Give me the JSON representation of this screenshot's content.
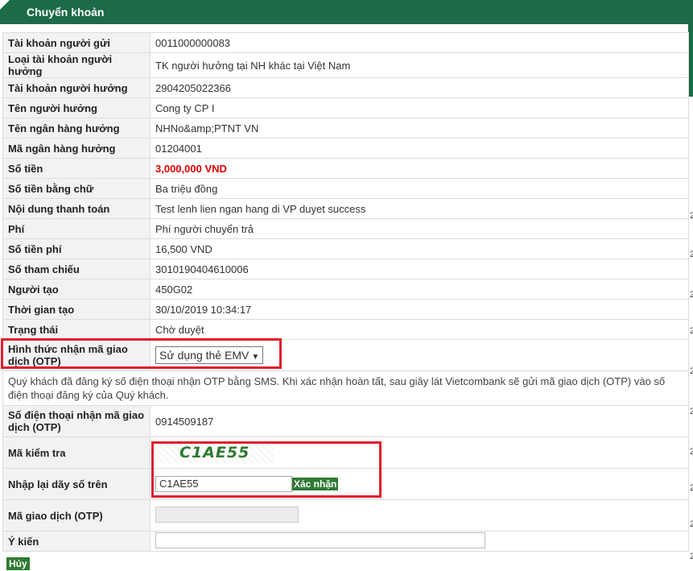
{
  "header": {
    "title": "Chuyển khoản"
  },
  "rows": {
    "sender_account": {
      "label": "Tài khoản người gửi",
      "value": "0011000000083"
    },
    "beneficiary_type": {
      "label": "Loại tài khoản người hưởng",
      "value": "TK người hưởng tại NH khác tại Việt Nam"
    },
    "beneficiary_account": {
      "label": "Tài khoản người hưởng",
      "value": "2904205022366"
    },
    "beneficiary_name": {
      "label": "Tên người hưởng",
      "value": "Cong ty CP I"
    },
    "bank_name": {
      "label": "Tên ngân hàng hưởng",
      "value": "NHNo&amp;PTNT VN"
    },
    "bank_code": {
      "label": "Mã ngân hàng hưởng",
      "value": "01204001"
    },
    "amount": {
      "label": "Số tiền",
      "value": "3,000,000 VND"
    },
    "amount_words": {
      "label": "Số tiền bằng chữ",
      "value": "Ba triệu đồng"
    },
    "payment_content": {
      "label": "Nội dung thanh toán",
      "value": "Test lenh lien ngan hang di VP duyet success"
    },
    "fee": {
      "label": "Phí",
      "value": "Phí người chuyển trả"
    },
    "fee_amount": {
      "label": "Số tiền phí",
      "value": "16,500 VND"
    },
    "reference": {
      "label": "Số tham chiếu",
      "value": "3010190404610006"
    },
    "creator": {
      "label": "Người tạo",
      "value": "450G02"
    },
    "created_time": {
      "label": "Thời gian tạo",
      "value": "30/10/2019 10:34:17"
    },
    "status": {
      "label": "Trạng thái",
      "value": "Chờ duyệt"
    },
    "otp_method": {
      "label": "Hình thức nhận mã giao dịch (OTP)",
      "selected": "Sử dụng thẻ EMV"
    },
    "note": "Quý khách đã đăng ký số điện thoại nhận OTP bằng SMS. Khi xác nhận hoàn tất, sau giây lát Vietcombank sẽ gửi mã giao dịch (OTP) vào số điện thoại đăng ký của Quý khách.",
    "otp_phone": {
      "label": "Số điện thoại nhận mã giao dịch (OTP)",
      "value": "0914509187"
    },
    "captcha": {
      "label": "Mã kiểm tra",
      "value": "C1AE55"
    },
    "captcha_input": {
      "label": "Nhập lại dãy số trên",
      "value": "C1AE55",
      "button": "Xác nhận"
    },
    "otp_code": {
      "label": "Mã giao dịch (OTP)"
    },
    "comment": {
      "label": "Ý kiến"
    }
  },
  "footer": {
    "cancel": "Hủy"
  },
  "side_marks": [
    "2",
    "2",
    "2",
    "2",
    "2",
    "2",
    "2",
    "2",
    "2",
    "2"
  ],
  "colors": {
    "header": "#1c6b46",
    "amount": "#e00000",
    "button": "#2f7a33",
    "highlight_box": "#e01e2e"
  }
}
